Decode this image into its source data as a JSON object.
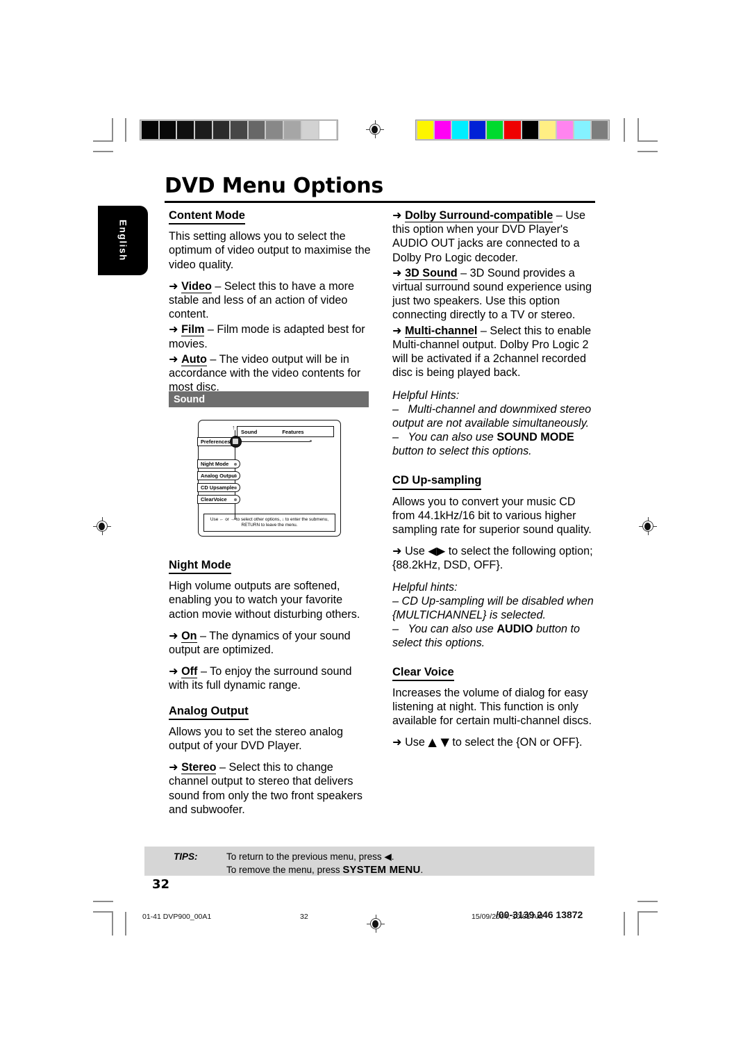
{
  "page": {
    "title": "DVD Menu Options",
    "language_tab": "English",
    "page_number": "32"
  },
  "calibration": {
    "grayscale": [
      "#050505",
      "#080808",
      "#101010",
      "#1d1d1d",
      "#2b2b2b",
      "#474747",
      "#676767",
      "#888888",
      "#a6a6a6",
      "#d2d2d2",
      "#ffffff"
    ],
    "colors": [
      "#fdf500",
      "#ff00f5",
      "#00eeff",
      "#0021d6",
      "#00da2d",
      "#ef0000",
      "#000000",
      "#ffef84",
      "#ff84ef",
      "#84f2ff",
      "#7d7d7d"
    ]
  },
  "left_column": {
    "content_mode": {
      "heading": "Content Mode",
      "intro": "This setting allows you to select the optimum of video output to maximise the video quality.",
      "options": [
        {
          "arrow": "➜",
          "term": "Video",
          "dash": " – ",
          "text": "Select this to have a more stable and less of an action of video content."
        },
        {
          "arrow": "➜",
          "term": "Film",
          "dash": " – ",
          "text": "Film mode is adapted best for movies."
        },
        {
          "arrow": "➜",
          "term": "Auto",
          "dash": " – ",
          "text": "The video output will be in accordance with the video contents for most disc."
        }
      ]
    },
    "sound_bar_label": "Sound",
    "osd": {
      "header_left": "Sound",
      "header_right": "Features",
      "selected_item": "Preferences",
      "items": [
        "Night Mode",
        "Analog Output",
        "CD Upsample",
        "ClearVoice"
      ],
      "footer_line1": "Use ← or → to select other options, ↓ to enter the submenu,",
      "footer_line2": "RETURN to leave the menu."
    },
    "night_mode": {
      "heading": "Night Mode",
      "intro": "High volume outputs are softened, enabling you to watch your favorite action movie without disturbing others.",
      "options": [
        {
          "arrow": "➜",
          "term": "On",
          "dash": " – ",
          "text": "The dynamics of your sound output are optimized."
        },
        {
          "arrow": "➜",
          "term": "Off",
          "dash": " – ",
          "text": "To enjoy the surround sound with its full dynamic range."
        }
      ]
    },
    "analog_output": {
      "heading": "Analog Output",
      "intro": "Allows you to set the stereo analog output of your DVD Player.",
      "options": [
        {
          "arrow": "➜",
          "term": "Stereo",
          "dash": " – ",
          "text": "Select this to change channel output to stereo that delivers sound from only the two front speakers and subwoofer."
        }
      ]
    }
  },
  "right_column": {
    "analog_output_cont": {
      "options": [
        {
          "arrow": "➜",
          "term": "Dolby Surround-compatible",
          "dash": " – ",
          "text": "Use this option when your DVD Player's AUDIO OUT jacks are connected to a Dolby Pro Logic decoder."
        },
        {
          "arrow": "➜",
          "term": "3D Sound",
          "dash": " – ",
          "text": "3D Sound provides a virtual surround sound experience using just two speakers. Use this option connecting directly to a TV or stereo."
        },
        {
          "arrow": "➜",
          "term": "Multi-channel",
          "dash": " – ",
          "text": "Select this to enable Multi-channel output. Dolby Pro Logic 2 will be activated if a 2channel recorded disc is being played back."
        }
      ],
      "hints_title": "Helpful Hints:",
      "hint1_dash": "–",
      "hint1": "Multi-channel and downmixed stereo output are not available simultaneously.",
      "hint2_dash": "–",
      "hint2_pre": "You can also use ",
      "hint2_caps": "SOUND MODE",
      "hint2_post": " button to select this options."
    },
    "cd_upsampling": {
      "heading": "CD Up-sampling",
      "intro": "Allows you to convert your music CD from 44.1kHz/16 bit to various higher sampling rate for superior sound quality.",
      "usage_arrow": "➜",
      "usage_pre": "Use ",
      "usage_keys": "◀▶",
      "usage_post": " to select the following option; {88.2kHz, DSD, OFF}.",
      "hints_title": "Helpful hints:",
      "hint1": "– CD Up-sampling will be disabled when {MULTICHANNEL} is selected.",
      "hint2_dash": "–",
      "hint2_pre": "You can also use ",
      "hint2_caps": "AUDIO",
      "hint2_post": " button to select this options."
    },
    "clear_voice": {
      "heading": "Clear Voice",
      "intro": "Increases the volume of dialog for easy listening at night. This function is only available for certain multi-channel discs.",
      "usage_arrow": "➜",
      "usage_pre": "Use ",
      "usage_keys": "▲ ▼",
      "usage_post": " to select the {ON or OFF}."
    }
  },
  "tips": {
    "label": "TIPS:",
    "line1": "To return to the previous menu, press ◀.",
    "line2_pre": "To remove the menu, press ",
    "line2_bold": "SYSTEM MENU",
    "line2_post": "."
  },
  "print_slug": {
    "file": "01-41 DVP900_00A1",
    "page": "32",
    "timestamp": "15/09/2004, 10:01 AM",
    "code": "/00-3139 246 13872"
  }
}
